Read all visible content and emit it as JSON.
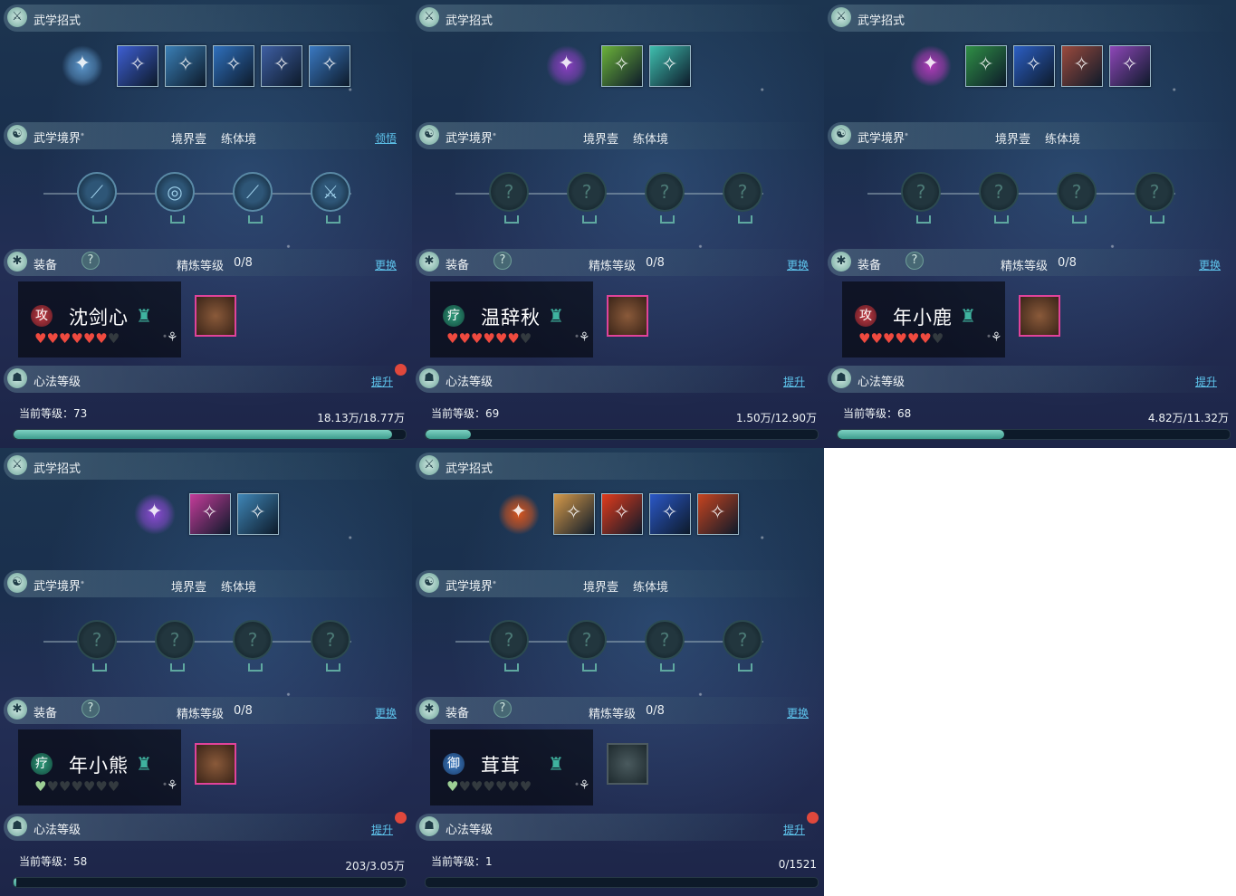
{
  "labels": {
    "skills_title": "武学招式",
    "realm_title": "武学境界",
    "realm_level": "境界壹",
    "realm_stage": "练体境",
    "equip_title": "装备",
    "question": "?",
    "refine_label": "精炼等级",
    "change": "更换",
    "xinfa_title": "心法等级",
    "upgrade": "提升",
    "comprehend": "领悟",
    "current_level": "当前等级："
  },
  "panels": [
    {
      "character": {
        "name": "沈剑心",
        "role": "攻"
      },
      "refine": "0/8",
      "show_comprehend": true,
      "level": "73",
      "exp": "18.13万/18.77万",
      "progress": 0.966,
      "hearts": {
        "filled": 6,
        "total": 7,
        "color": "red"
      },
      "equip_icon": "armor-icon",
      "skill_icons": [
        "wind-orb-icon",
        "dash-icon",
        "vortex-icon",
        "strike-icon",
        "blade-icon",
        "spin-icon"
      ],
      "skill_colors": [
        "#5b95c9",
        "#3e5fd3",
        "#3a7fb6",
        "#2f70bd",
        "#3e5fa3",
        "#3a79c2"
      ],
      "realm_nodes_lit": true,
      "dot": true
    },
    {
      "character": {
        "name": "温辞秋",
        "role": "疗"
      },
      "refine": "0/8",
      "show_comprehend": false,
      "level": "69",
      "exp": "1.50万/12.90万",
      "progress": 0.116,
      "hearts": {
        "filled": 6,
        "total": 7,
        "color": "red"
      },
      "equip_icon": "helmet-icon",
      "skill_icons": [
        "spirit-icon",
        "hands-icon",
        "radiance-icon"
      ],
      "skill_colors": [
        "#8a3fc1",
        "#6bb23a",
        "#3fbfae"
      ],
      "realm_nodes_lit": false,
      "dot": false
    },
    {
      "character": {
        "name": "年小鹿",
        "role": "攻"
      },
      "refine": "0/8",
      "show_comprehend": false,
      "level": "68",
      "exp": "4.82万/11.32万",
      "progress": 0.426,
      "hearts": {
        "filled": 6,
        "total": 7,
        "color": "red"
      },
      "equip_icon": "helmet-icon",
      "skill_icons": [
        "rune-icon",
        "claw-icon",
        "serpent-icon",
        "rock-icon",
        "mist-icon"
      ],
      "skill_colors": [
        "#b03ab8",
        "#2f8f45",
        "#2c5fc4",
        "#9b4a3d",
        "#8e47b8"
      ],
      "realm_nodes_lit": false,
      "dot": false
    },
    {
      "character": {
        "name": "年小熊",
        "role": "疗"
      },
      "refine": "0/8",
      "show_comprehend": false,
      "level": "58",
      "exp": "203/3.05万",
      "progress": 0.007,
      "hearts": {
        "filled": 1,
        "total": 7,
        "color": "green"
      },
      "equip_icon": "robe-icon",
      "skill_icons": [
        "crystal-icon",
        "petal-icon",
        "fan-icon"
      ],
      "skill_colors": [
        "#8a4ad1",
        "#c53c9a",
        "#3f86b6"
      ],
      "realm_nodes_lit": false,
      "dot": true
    },
    {
      "character": {
        "name": "茸茸",
        "role": "御"
      },
      "refine": "0/8",
      "show_comprehend": false,
      "level": "1",
      "exp": "0/1521",
      "progress": 0,
      "hearts": {
        "filled": 1,
        "total": 7,
        "color": "green"
      },
      "equip_icon": "empty-armor-icon",
      "skill_icons": [
        "flame-icon",
        "face-icon",
        "burst-icon",
        "crescent-icon",
        "swirl-icon"
      ],
      "skill_colors": [
        "#d8561e",
        "#d69a4a",
        "#e23b1c",
        "#2b58c7",
        "#c7441f"
      ],
      "realm_nodes_lit": false,
      "dot": true
    }
  ]
}
